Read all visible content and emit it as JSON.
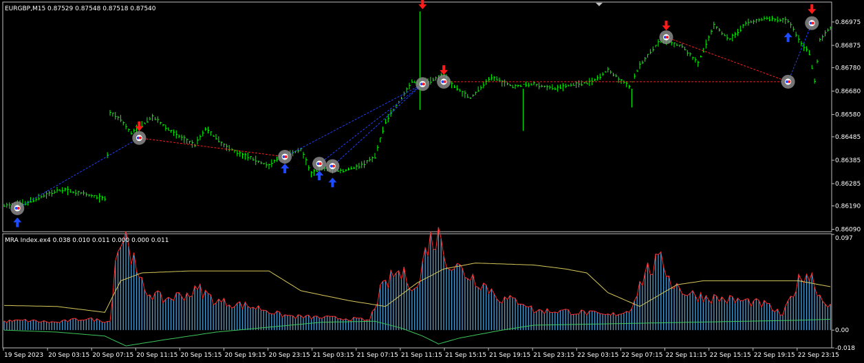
{
  "main_header": "EURGBP,M15  0.87529 0.87548 0.87518 0.87540",
  "indicator_header": "MRA Index.ex4 0.038 0.010 0.011 0.000 0.000 0.011",
  "colors": {
    "background": "#000000",
    "frame": "#c0c0c0",
    "price_bars": "#00ff00",
    "up_arrow": "#1e4bff",
    "down_arrow": "#ff1a1a",
    "zigzag_red": "#ff2020",
    "zigzag_blue": "#2040ff",
    "histogram": "#4a9fd8",
    "red_line": "#ff2a2a",
    "yellow_line": "#d8c85a",
    "green_line": "#3cc85a",
    "text": "#ffffff"
  },
  "chart_data": [
    {
      "type": "ohlc",
      "symbol": "EURGBP",
      "timeframe": "M15",
      "y_ticks": [
        "0.86975",
        "0.86875",
        "0.86780",
        "0.86680",
        "0.86580",
        "0.86485",
        "0.86385",
        "0.86285",
        "0.86190",
        "0.86090"
      ],
      "ylim": [
        0.8608,
        0.8706
      ],
      "x_ticks": [
        "19 Sep 2023",
        "20 Sep 03:15",
        "20 Sep 07:15",
        "20 Sep 11:15",
        "20 Sep 15:15",
        "20 Sep 19:15",
        "20 Sep 23:15",
        "21 Sep 03:15",
        "21 Sep 07:15",
        "21 Sep 11:15",
        "21 Sep 15:15",
        "21 Sep 19:15",
        "21 Sep 23:15",
        "22 Sep 03:15",
        "22 Sep 07:15",
        "22 Sep 11:15",
        "22 Sep 15:15",
        "22 Sep 19:15",
        "22 Sep 23:15"
      ],
      "price_path": [
        [
          0,
          0.8619
        ],
        [
          8,
          0.862
        ],
        [
          16,
          0.8624
        ],
        [
          22,
          0.8626
        ],
        [
          30,
          0.8624
        ],
        [
          38,
          0.8622
        ],
        [
          40,
          0.8659
        ],
        [
          44,
          0.8656
        ],
        [
          48,
          0.865
        ],
        [
          56,
          0.8657
        ],
        [
          64,
          0.865
        ],
        [
          72,
          0.8645
        ],
        [
          76,
          0.8652
        ],
        [
          84,
          0.8644
        ],
        [
          92,
          0.864
        ],
        [
          100,
          0.8636
        ],
        [
          104,
          0.864
        ],
        [
          112,
          0.8643
        ],
        [
          116,
          0.8633
        ],
        [
          120,
          0.8635
        ],
        [
          128,
          0.8634
        ],
        [
          134,
          0.8636
        ],
        [
          140,
          0.864
        ],
        [
          144,
          0.8655
        ],
        [
          150,
          0.8665
        ],
        [
          154,
          0.8672
        ],
        [
          158,
          0.8671
        ],
        [
          166,
          0.8675
        ],
        [
          170,
          0.867
        ],
        [
          176,
          0.8665
        ],
        [
          184,
          0.8674
        ],
        [
          192,
          0.867
        ],
        [
          200,
          0.8671
        ],
        [
          208,
          0.8669
        ],
        [
          216,
          0.8671
        ],
        [
          222,
          0.8672
        ],
        [
          228,
          0.8677
        ],
        [
          236,
          0.867
        ],
        [
          240,
          0.8679
        ],
        [
          248,
          0.869
        ],
        [
          256,
          0.8687
        ],
        [
          262,
          0.868
        ],
        [
          268,
          0.8696
        ],
        [
          274,
          0.869
        ],
        [
          280,
          0.8697
        ],
        [
          288,
          0.8699
        ],
        [
          296,
          0.8698
        ],
        [
          300,
          0.869
        ],
        [
          304,
          0.8684
        ],
        [
          306,
          0.8672
        ],
        [
          308,
          0.869
        ],
        [
          312,
          0.8695
        ],
        [
          316,
          0.8698
        ]
      ],
      "spikes": [
        {
          "x": 157,
          "high": 0.8702,
          "low": 0.866
        },
        {
          "x": 196,
          "high": 0.8669,
          "low": 0.8651
        },
        {
          "x": 237,
          "high": 0.8669,
          "low": 0.8661
        }
      ],
      "zigzag_points": [
        {
          "x": 5,
          "price": 0.8618,
          "kind": "low"
        },
        {
          "x": 51,
          "price": 0.8648,
          "kind": "high"
        },
        {
          "x": 106,
          "price": 0.864,
          "kind": "low"
        },
        {
          "x": 119,
          "price": 0.8637,
          "kind": "low"
        },
        {
          "x": 124,
          "price": 0.8636,
          "kind": "low"
        },
        {
          "x": 158,
          "price": 0.8671,
          "kind": "high"
        },
        {
          "x": 166,
          "price": 0.8672,
          "kind": "high"
        },
        {
          "x": 250,
          "price": 0.8691,
          "kind": "high"
        },
        {
          "x": 296,
          "price": 0.8672,
          "kind": "low"
        },
        {
          "x": 305,
          "price": 0.8697,
          "kind": "high"
        }
      ],
      "red_dashed": [
        [
          51,
          0.8648
        ],
        [
          106,
          0.864
        ],
        [
          166,
          0.8672
        ],
        [
          296,
          0.8672
        ],
        [
          250,
          0.8691
        ],
        [
          296,
          0.8672
        ]
      ],
      "blue_dashed": [
        [
          [
            5,
            0.8618
          ],
          [
            51,
            0.8648
          ]
        ],
        [
          [
            106,
            0.864
          ],
          [
            158,
            0.8671
          ]
        ],
        [
          [
            119,
            0.8637
          ],
          [
            158,
            0.8671
          ]
        ],
        [
          [
            124,
            0.8636
          ],
          [
            158,
            0.8671
          ]
        ],
        [
          [
            296,
            0.8672
          ],
          [
            305,
            0.8697
          ]
        ]
      ],
      "up_arrows": [
        {
          "x": 5,
          "price": 0.8612
        },
        {
          "x": 106,
          "price": 0.8635
        },
        {
          "x": 119,
          "price": 0.8632
        },
        {
          "x": 124,
          "price": 0.8629
        },
        {
          "x": 296,
          "price": 0.8691
        }
      ],
      "down_arrows": [
        {
          "x": 51,
          "price": 0.8653
        },
        {
          "x": 158,
          "price": 0.8705
        },
        {
          "x": 166,
          "price": 0.8677
        },
        {
          "x": 250,
          "price": 0.8696
        },
        {
          "x": 305,
          "price": 0.8703
        }
      ]
    },
    {
      "type": "histogram+lines",
      "name": "MRA Index",
      "y_ticks": [
        "0.097",
        "0.00",
        "-0.018"
      ],
      "ylim": [
        -0.018,
        0.097
      ],
      "histogram_path": [
        [
          0,
          0.009
        ],
        [
          8,
          0.01
        ],
        [
          20,
          0.008
        ],
        [
          30,
          0.012
        ],
        [
          40,
          0.009
        ],
        [
          42,
          0.075
        ],
        [
          44,
          0.093
        ],
        [
          47,
          0.097
        ],
        [
          50,
          0.055
        ],
        [
          54,
          0.04
        ],
        [
          60,
          0.032
        ],
        [
          70,
          0.038
        ],
        [
          74,
          0.042
        ],
        [
          80,
          0.03
        ],
        [
          90,
          0.026
        ],
        [
          98,
          0.022
        ],
        [
          104,
          0.016
        ],
        [
          110,
          0.014
        ],
        [
          120,
          0.013
        ],
        [
          130,
          0.012
        ],
        [
          138,
          0.01
        ],
        [
          142,
          0.04
        ],
        [
          148,
          0.06
        ],
        [
          152,
          0.055
        ],
        [
          156,
          0.042
        ],
        [
          160,
          0.092
        ],
        [
          163,
          0.095
        ],
        [
          165,
          0.097
        ],
        [
          168,
          0.07
        ],
        [
          174,
          0.06
        ],
        [
          180,
          0.05
        ],
        [
          188,
          0.032
        ],
        [
          196,
          0.03
        ],
        [
          200,
          0.02
        ],
        [
          210,
          0.02
        ],
        [
          220,
          0.018
        ],
        [
          228,
          0.015
        ],
        [
          236,
          0.02
        ],
        [
          242,
          0.06
        ],
        [
          246,
          0.068
        ],
        [
          249,
          0.07
        ],
        [
          252,
          0.05
        ],
        [
          258,
          0.038
        ],
        [
          266,
          0.034
        ],
        [
          272,
          0.032
        ],
        [
          280,
          0.03
        ],
        [
          288,
          0.026
        ],
        [
          294,
          0.015
        ],
        [
          298,
          0.04
        ],
        [
          302,
          0.06
        ],
        [
          305,
          0.055
        ],
        [
          309,
          0.03
        ],
        [
          312,
          0.028
        ]
      ],
      "yellow_path": [
        [
          0,
          0.025
        ],
        [
          20,
          0.024
        ],
        [
          38,
          0.018
        ],
        [
          44,
          0.05
        ],
        [
          52,
          0.058
        ],
        [
          70,
          0.06
        ],
        [
          100,
          0.06
        ],
        [
          106,
          0.05
        ],
        [
          112,
          0.04
        ],
        [
          130,
          0.03
        ],
        [
          144,
          0.024
        ],
        [
          156,
          0.048
        ],
        [
          166,
          0.062
        ],
        [
          178,
          0.068
        ],
        [
          200,
          0.066
        ],
        [
          212,
          0.062
        ],
        [
          220,
          0.058
        ],
        [
          228,
          0.038
        ],
        [
          240,
          0.024
        ],
        [
          254,
          0.046
        ],
        [
          264,
          0.05
        ],
        [
          280,
          0.05
        ],
        [
          300,
          0.05
        ],
        [
          312,
          0.044
        ]
      ],
      "green_path": [
        [
          0,
          0.0
        ],
        [
          20,
          -0.002
        ],
        [
          38,
          -0.006
        ],
        [
          46,
          -0.016
        ],
        [
          60,
          -0.01
        ],
        [
          80,
          -0.002
        ],
        [
          100,
          0.003
        ],
        [
          120,
          0.008
        ],
        [
          140,
          0.009
        ],
        [
          150,
          0.002
        ],
        [
          158,
          -0.006
        ],
        [
          164,
          -0.014
        ],
        [
          172,
          -0.008
        ],
        [
          188,
          0.0
        ],
        [
          200,
          0.005
        ],
        [
          220,
          0.006
        ],
        [
          240,
          0.007
        ],
        [
          260,
          0.008
        ],
        [
          280,
          0.009
        ],
        [
          300,
          0.01
        ],
        [
          312,
          0.011
        ]
      ]
    }
  ]
}
